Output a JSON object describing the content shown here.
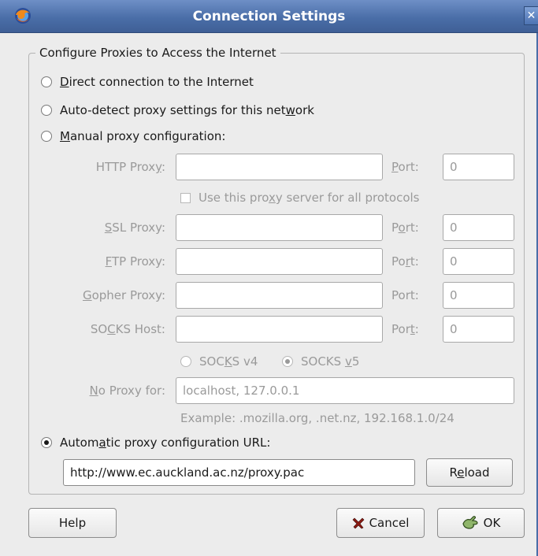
{
  "window": {
    "title": "Connection Settings",
    "close_glyph": "✕"
  },
  "group": {
    "legend": "Configure Proxies to Access the Internet"
  },
  "modes": {
    "direct": {
      "pre": "",
      "key": "D",
      "post": "irect connection to the Internet",
      "checked": false
    },
    "autodetect": {
      "pre": "Auto-detect proxy settings for this net",
      "key": "w",
      "post": "ork",
      "checked": false
    },
    "manual": {
      "pre": "",
      "key": "M",
      "post": "anual proxy configuration:",
      "checked": false
    },
    "autourl": {
      "pre": "Autom",
      "key": "a",
      "post": "tic proxy configuration URL:",
      "checked": true
    }
  },
  "manual": {
    "http": {
      "pre": "HTTP Prox",
      "key": "y",
      "post": ":",
      "value": "",
      "port_pre": "",
      "port_key": "P",
      "port_post": "ort:",
      "port": "0"
    },
    "use_for_all": {
      "pre": "Use this pro",
      "key": "x",
      "post": "y server for all protocols",
      "checked": false
    },
    "ssl": {
      "pre": "",
      "key": "S",
      "post": "SL Proxy:",
      "value": "",
      "port_pre": "P",
      "port_key": "o",
      "port_post": "rt:",
      "port": "0"
    },
    "ftp": {
      "pre": "",
      "key": "F",
      "post": "TP Proxy:",
      "value": "",
      "port_pre": "Po",
      "port_key": "r",
      "port_post": "t:",
      "port": "0"
    },
    "gopher": {
      "pre": "",
      "key": "G",
      "post": "opher Proxy:",
      "value": "",
      "port_pre": "Port:",
      "port_key": "",
      "port_post": "",
      "port": "0"
    },
    "socks": {
      "pre": "SO",
      "key": "C",
      "post": "KS Host:",
      "value": "",
      "port_pre": "Por",
      "port_key": "t",
      "port_post": ":",
      "port": "0"
    },
    "socks_v4": {
      "pre": "SOC",
      "key": "K",
      "post": "S v4",
      "checked": false
    },
    "socks_v5": {
      "pre": "SOCKS ",
      "key": "v",
      "post": "5",
      "checked": true
    },
    "no_proxy": {
      "pre": "",
      "key": "N",
      "post": "o Proxy for:",
      "value": "localhost, 127.0.0.1"
    },
    "example": "Example: .mozilla.org, .net.nz, 192.168.1.0/24"
  },
  "autourl": {
    "value": "http://www.ec.auckland.ac.nz/proxy.pac",
    "reload_pre": "R",
    "reload_key": "e",
    "reload_post": "load"
  },
  "buttons": {
    "help": "Help",
    "cancel": "Cancel",
    "ok": "OK"
  },
  "icons": {
    "app": "firefox-icon",
    "close": "close-icon",
    "cancel": "cancel-x-icon",
    "ok": "ok-hand-icon"
  }
}
